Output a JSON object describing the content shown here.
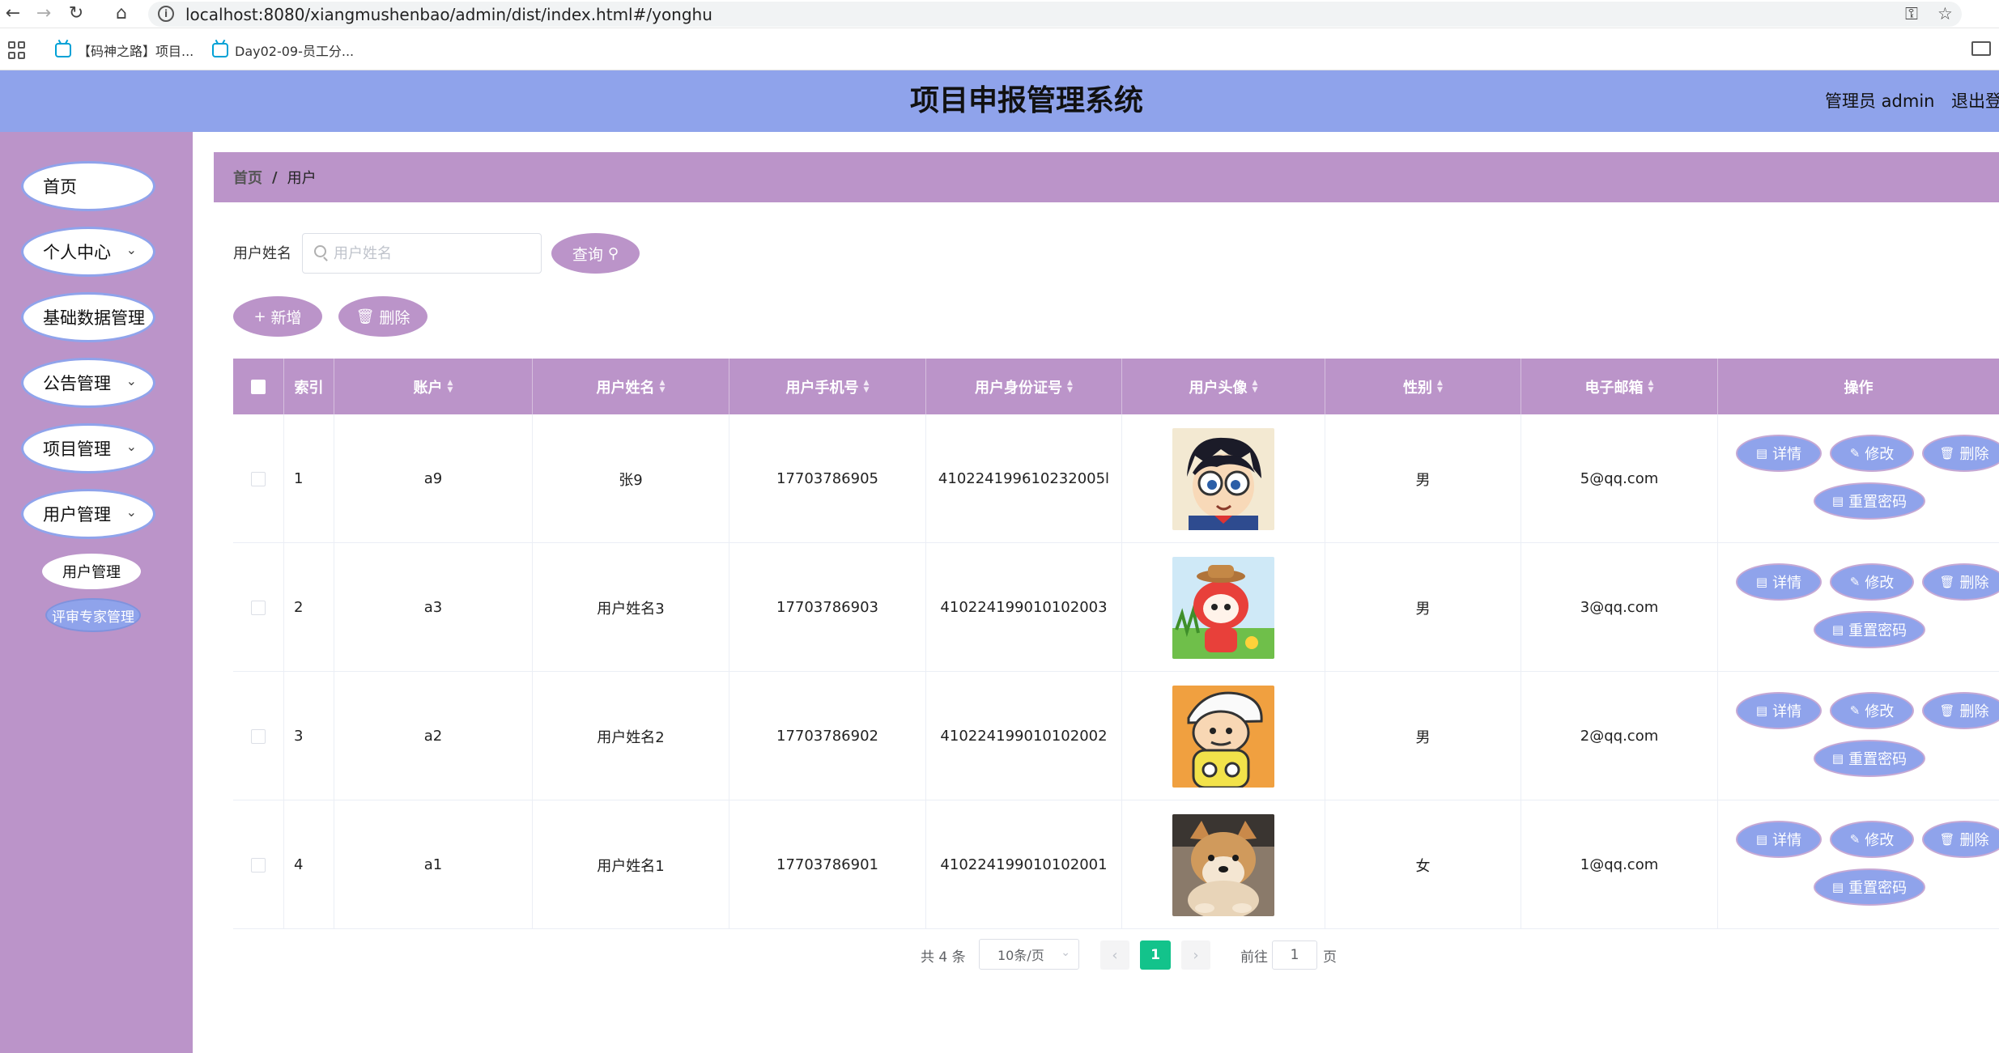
{
  "browser": {
    "url": "localhost:8080/xiangmushenbao/admin/dist/index.html#/yonghu",
    "bookmarks": [
      "【码神之路】项目...",
      "Day02-09-员工分..."
    ]
  },
  "header": {
    "title": "项目申报管理系统",
    "user": "管理员 admin",
    "logout": "退出登"
  },
  "sidebar": {
    "items": [
      {
        "label": "首页"
      },
      {
        "label": "个人中心"
      },
      {
        "label": "基础数据管理"
      },
      {
        "label": "公告管理"
      },
      {
        "label": "项目管理"
      },
      {
        "label": "用户管理"
      }
    ],
    "subitems": [
      {
        "label": "用户管理"
      },
      {
        "label": "评审专家管理"
      }
    ]
  },
  "breadcrumb": {
    "home": "首页",
    "separator": "/",
    "current": "用户"
  },
  "search": {
    "label": "用户姓名",
    "placeholder": "用户姓名",
    "button": "查询"
  },
  "toolbar": {
    "add": "新增",
    "delete": "删除"
  },
  "table": {
    "headers": [
      "索引",
      "账户",
      "用户姓名",
      "用户手机号",
      "用户身份证号",
      "用户头像",
      "性别",
      "电子邮箱",
      "操作"
    ],
    "rows": [
      {
        "index": "1",
        "account": "a9",
        "name": "张9",
        "phone": "17703786905",
        "idcard": "410224199610232005l",
        "gender": "男",
        "email": "5@qq.com"
      },
      {
        "index": "2",
        "account": "a3",
        "name": "用户姓名3",
        "phone": "17703786903",
        "idcard": "410224199010102003",
        "gender": "男",
        "email": "3@qq.com"
      },
      {
        "index": "3",
        "account": "a2",
        "name": "用户姓名2",
        "phone": "17703786902",
        "idcard": "410224199010102002",
        "gender": "男",
        "email": "2@qq.com"
      },
      {
        "index": "4",
        "account": "a1",
        "name": "用户姓名1",
        "phone": "17703786901",
        "idcard": "410224199010102001",
        "gender": "女",
        "email": "1@qq.com"
      }
    ],
    "actions": {
      "detail": "详情",
      "edit": "修改",
      "delete": "删除",
      "reset": "重置密码"
    }
  },
  "pagination": {
    "total": "共 4 条",
    "page_size": "10条/页",
    "current_page": "1",
    "goto_label": "前往",
    "goto_value": "1",
    "page_unit": "页"
  },
  "colors": {
    "accent_purple": "#bb94c9",
    "accent_blue": "#8fa3eb",
    "pager_active": "#13c38b"
  }
}
